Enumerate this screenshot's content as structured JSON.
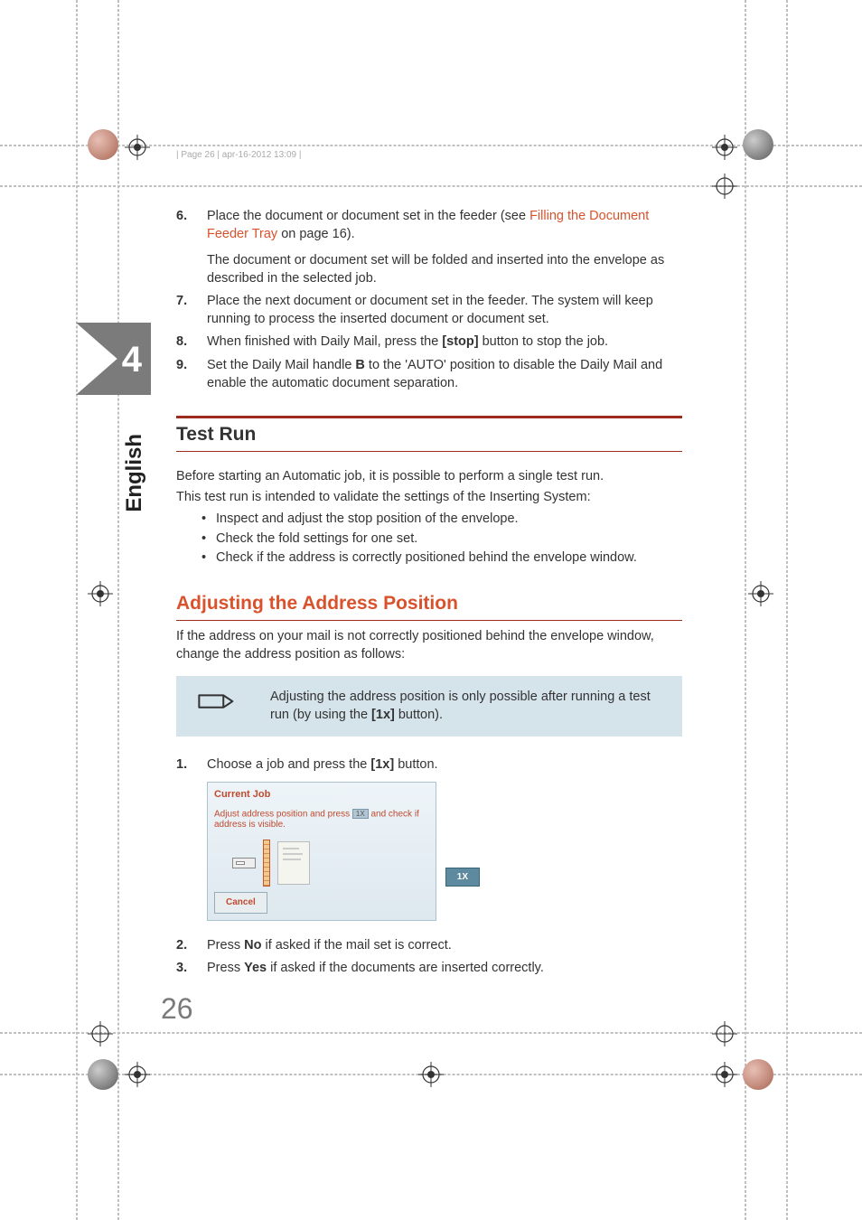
{
  "header": {
    "info": "| Page 26 | apr-16-2012 13:09 |"
  },
  "sectionNumber": "4",
  "language": "English",
  "steps1": [
    {
      "num": "6.",
      "text_pre": "Place the document or document set in the feeder (see ",
      "link": "Filling the Document Feeder Tray",
      "text_post": " on page 16).",
      "sub": "The document or document set will be folded and inserted into the envelope as described in the selected job."
    },
    {
      "num": "7.",
      "text": "Place the next document or document set in the feeder. The system will keep running to process the inserted document or document set."
    },
    {
      "num": "8.",
      "text_pre": "When finished with Daily Mail, press the ",
      "bold": "[stop]",
      "text_post": " button to stop the job."
    },
    {
      "num": "9.",
      "text_pre": "Set the Daily Mail handle ",
      "bold": "B",
      "text_post": " to the 'AUTO' position to disable the Daily Mail and enable the automatic document separation."
    }
  ],
  "testRun": {
    "heading": "Test Run",
    "p1": "Before starting an Automatic job, it is possible to perform a single test run.",
    "p2": "This test run is intended to validate the settings of the Inserting System:",
    "bullets": [
      "Inspect and adjust the stop position of the envelope.",
      "Check the fold settings for one set.",
      "Check if the address is correctly positioned behind the envelope window."
    ]
  },
  "adjusting": {
    "heading": "Adjusting the Address Position",
    "intro": "If the address on your mail is not correctly positioned behind the envelope window, change the address position as follows:",
    "note_pre": "Adjusting the address position is only possible after running a test run (by using the ",
    "note_bold": "[1x]",
    "note_post": " button).",
    "steps": [
      {
        "num": "1.",
        "text_pre": "Choose a job and press the ",
        "bold": "[1x]",
        "text_post": " button."
      },
      {
        "num": "2.",
        "text_pre": "Press ",
        "bold": "No",
        "text_post": " if asked if the mail set is correct."
      },
      {
        "num": "3.",
        "text_pre": "Press ",
        "bold": "Yes",
        "text_post": " if asked if the documents are inserted correctly."
      }
    ]
  },
  "screenshot": {
    "title": "Current Job",
    "subtitle_pre": "Adjust address position and press",
    "subtitle_btn": "1X",
    "subtitle_post": "and check if address is visible.",
    "btn_1x": "1X",
    "cancel": "Cancel"
  },
  "pageNumber": "26"
}
